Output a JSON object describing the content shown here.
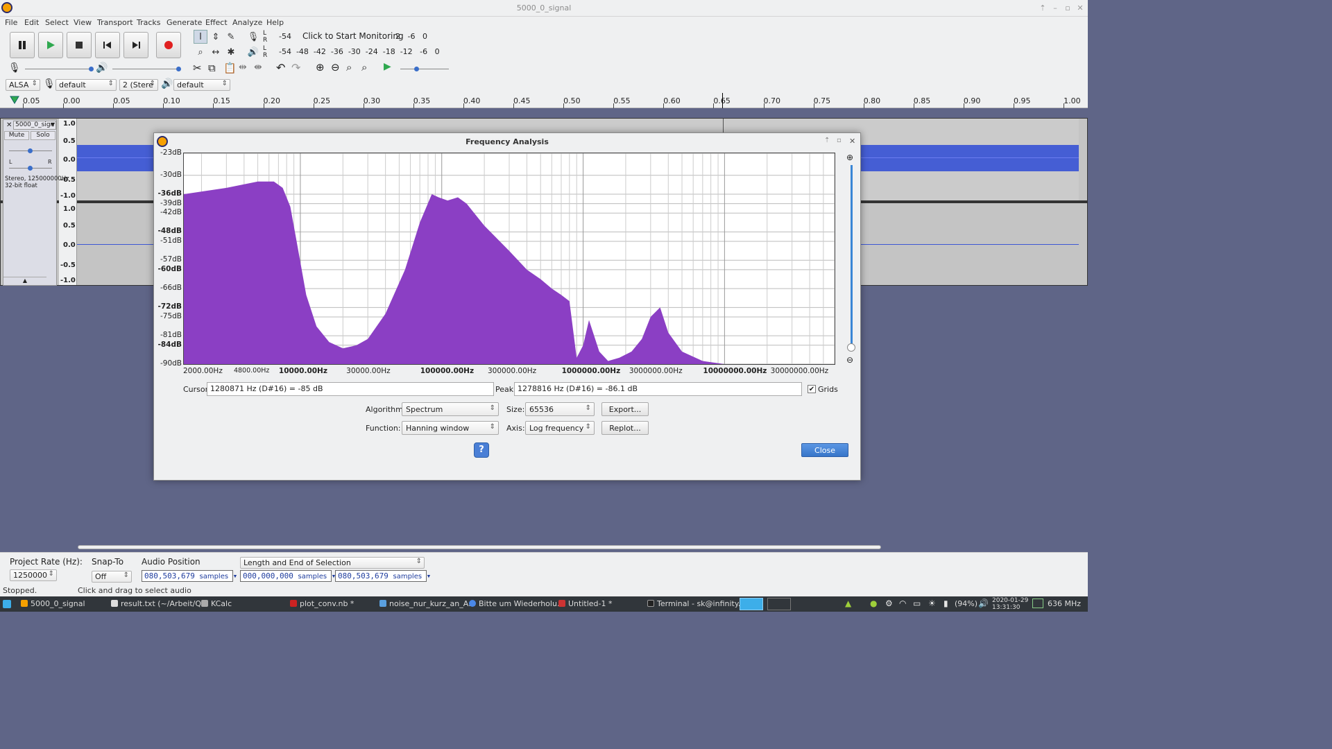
{
  "window": {
    "title": "5000_0_signal"
  },
  "menu": [
    "File",
    "Edit",
    "Select",
    "View",
    "Transport",
    "Tracks",
    "Generate",
    "Effect",
    "Analyze",
    "Help"
  ],
  "meters": {
    "record_lr": "L\nR",
    "record_left": "-54",
    "record_text": "Click to Start Monitoring",
    "record_right": "2   -6   0",
    "play_scale": "-54  -48  -42  -36  -30  -24  -18  -12   -6   0"
  },
  "device": {
    "host": "ALSA",
    "input": "default",
    "channels": "2 (Stere",
    "output": "default"
  },
  "ruler": [
    "0.05",
    "0.00",
    "0.05",
    "0.10",
    "0.15",
    "0.20",
    "0.25",
    "0.30",
    "0.35",
    "0.40",
    "0.45",
    "0.50",
    "0.55",
    "0.60",
    "0.65",
    "0.70",
    "0.75",
    "0.80",
    "0.85",
    "0.90",
    "0.95",
    "1.00"
  ],
  "track": {
    "name": "5000_0_sign",
    "mute": "Mute",
    "solo": "Solo",
    "info": "Stereo, 125000000Hz\n32-bit float",
    "scale_top": [
      "1.0",
      "0.5",
      "0.0",
      "-0.5",
      "-1.0"
    ],
    "scale_bottom": [
      "1.0",
      "0.5",
      "0.0",
      "-0.5",
      "-1.0"
    ]
  },
  "dialog": {
    "title": "Frequency Analysis",
    "cursor_label": "Cursor:",
    "cursor_value": "1280871 Hz (D#16) = -85 dB",
    "peak_label": "Peak:",
    "peak_value": "1278816 Hz (D#16) = -86.1 dB",
    "grids_label": "Grids",
    "algorithm_label": "Algorithm:",
    "algorithm_value": "Spectrum",
    "size_label": "Size:",
    "size_value": "65536",
    "export_label": "Export...",
    "function_label": "Function:",
    "function_value": "Hanning window",
    "axis_label": "Axis:",
    "axis_value": "Log frequency",
    "replot_label": "Replot...",
    "help_label": "?",
    "close_label": "Close"
  },
  "chart_data": {
    "type": "area",
    "title": "",
    "xscale": "log",
    "xlim": [
      1500,
      60000000
    ],
    "ylim": [
      -90,
      -23
    ],
    "grid": true,
    "y_tick_labels": [
      "-23dB",
      "-30dB",
      "-36dB",
      "-39dB",
      "-42dB",
      "-48dB",
      "-51dB",
      "-57dB",
      "-60dB",
      "-66dB",
      "-72dB",
      "-75dB",
      "-81dB",
      "-84dB",
      "-90dB"
    ],
    "x_tick_labels": [
      "2000.00Hz",
      "4800.00Hz",
      "10000.00Hz",
      "30000.00Hz",
      "100000.00Hz",
      "300000.00Hz",
      "1000000.00Hz",
      "3000000.00Hz",
      "10000000.00Hz",
      "30000000.00Hz"
    ],
    "x": [
      1500,
      3000,
      5000,
      6500,
      7500,
      8500,
      9500,
      11000,
      13000,
      16000,
      20000,
      25000,
      30000,
      40000,
      55000,
      70000,
      85000,
      95000,
      110000,
      130000,
      150000,
      200000,
      300000,
      400000,
      500000,
      600000,
      700000,
      800000,
      900000,
      1000000,
      1100000,
      1300000,
      1500000,
      1800000,
      2200000,
      2600000,
      3000000,
      3500000,
      4000000,
      5000000,
      7000000,
      10000000,
      20000000,
      60000000
    ],
    "values": [
      -36,
      -34,
      -32,
      -32,
      -34,
      -40,
      -52,
      -68,
      -78,
      -83,
      -85,
      -84,
      -82,
      -74,
      -60,
      -45,
      -36,
      -37,
      -38,
      -37,
      -39,
      -46,
      -54,
      -60,
      -63,
      -66,
      -68,
      -70,
      -88,
      -84,
      -76,
      -86,
      -89,
      -88,
      -86,
      -82,
      -75,
      -72,
      -80,
      -86,
      -89,
      -90,
      -90,
      -90
    ],
    "color": "#8b3fc4"
  },
  "selection": {
    "rate_label": "Project Rate (Hz):",
    "rate_value": "1250000",
    "snap_label": "Snap-To",
    "snap_value": "Off",
    "pos_label": "Audio Position",
    "pos_digits": "080,503,679",
    "pos_unit": "samples",
    "sel_mode": "Length and End of Selection",
    "start_digits": "000,000,000",
    "start_unit": "samples",
    "end_digits": "080,503,679",
    "end_unit": "samples"
  },
  "status": {
    "state": "Stopped.",
    "hint": "Click and drag to select audio"
  },
  "taskbar": {
    "items": [
      "5000_0_signal",
      "result.txt (~/Arbeit/Q...",
      "KCalc",
      "plot_conv.nb *",
      "noise_nur_kurz_an_A...",
      "Bitte um Wiederholu...",
      "Untitled-1 *",
      "Terminal - sk@infinity..."
    ],
    "battery": "(94%)",
    "date": "2020-01-29",
    "time": "13:31:30",
    "cpu": "636 MHz"
  }
}
